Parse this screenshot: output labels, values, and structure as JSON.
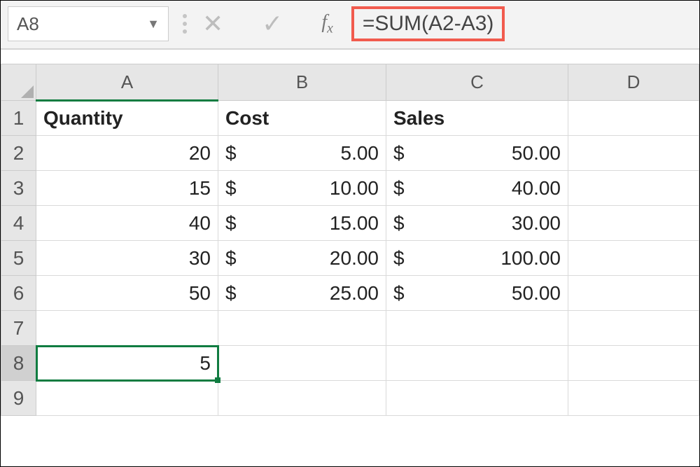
{
  "nameBox": "A8",
  "formula": "=SUM(A2-A3)",
  "icons": {
    "cancel": "✕",
    "enter": "✓",
    "fx_f": "f",
    "fx_x": "x"
  },
  "cols": [
    "A",
    "B",
    "C",
    "D"
  ],
  "rows": [
    "1",
    "2",
    "3",
    "4",
    "5",
    "6",
    "7",
    "8",
    "9"
  ],
  "headers": {
    "A": "Quantity",
    "B": "Cost",
    "C": "Sales"
  },
  "data": [
    {
      "qty": "20",
      "cost": "5.00",
      "sales": "50.00"
    },
    {
      "qty": "15",
      "cost": "10.00",
      "sales": "40.00"
    },
    {
      "qty": "40",
      "cost": "15.00",
      "sales": "30.00"
    },
    {
      "qty": "30",
      "cost": "20.00",
      "sales": "100.00"
    },
    {
      "qty": "50",
      "cost": "25.00",
      "sales": "50.00"
    }
  ],
  "currency": "$",
  "selectedValue": "5",
  "activeRow": "8"
}
